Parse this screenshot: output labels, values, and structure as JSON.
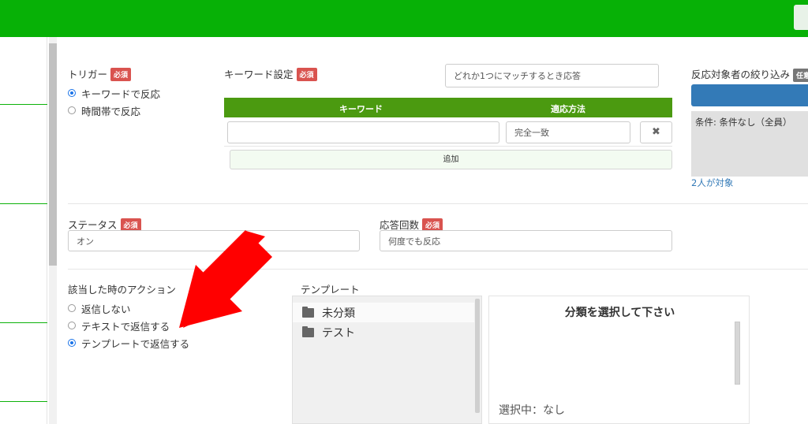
{
  "trigger": {
    "label": "トリガー",
    "required": "必須",
    "options": [
      "キーワードで反応",
      "時間帯で反応"
    ],
    "selected_index": 0
  },
  "keyword_settings": {
    "label": "キーワード設定",
    "required": "必須",
    "match_mode_value": "どれか1つにマッチするとき応答",
    "col_keyword": "キーワード",
    "col_method": "適応方法",
    "row_keyword_value": "",
    "row_method_value": "完全一致",
    "delete_icon": "✖",
    "add_label": "追加"
  },
  "target_filter": {
    "label": "反応対象者の絞り込み",
    "optional": "任意",
    "condition_text": "条件: 条件なし（全員）",
    "count_link": "2人が対象"
  },
  "status": {
    "label": "ステータス",
    "required": "必須",
    "value": "オン"
  },
  "response_count": {
    "label": "応答回数",
    "required": "必須",
    "value": "何度でも反応"
  },
  "action": {
    "label": "該当した時のアクション",
    "options": [
      "返信しない",
      "テキストで返信する",
      "テンプレートで返信する"
    ],
    "selected_index": 2
  },
  "template": {
    "label": "テンプレート",
    "folders": [
      "未分類",
      "テスト"
    ],
    "preview_title": "分類を選択して下さい",
    "selected_text": "選択中：なし"
  },
  "annotation": {
    "arrow_color": "#ff0000"
  },
  "colors": {
    "topbar": "#07b106",
    "table_header": "#4b9a10",
    "required_badge": "#d9534f",
    "filter_button": "#337ab7"
  }
}
